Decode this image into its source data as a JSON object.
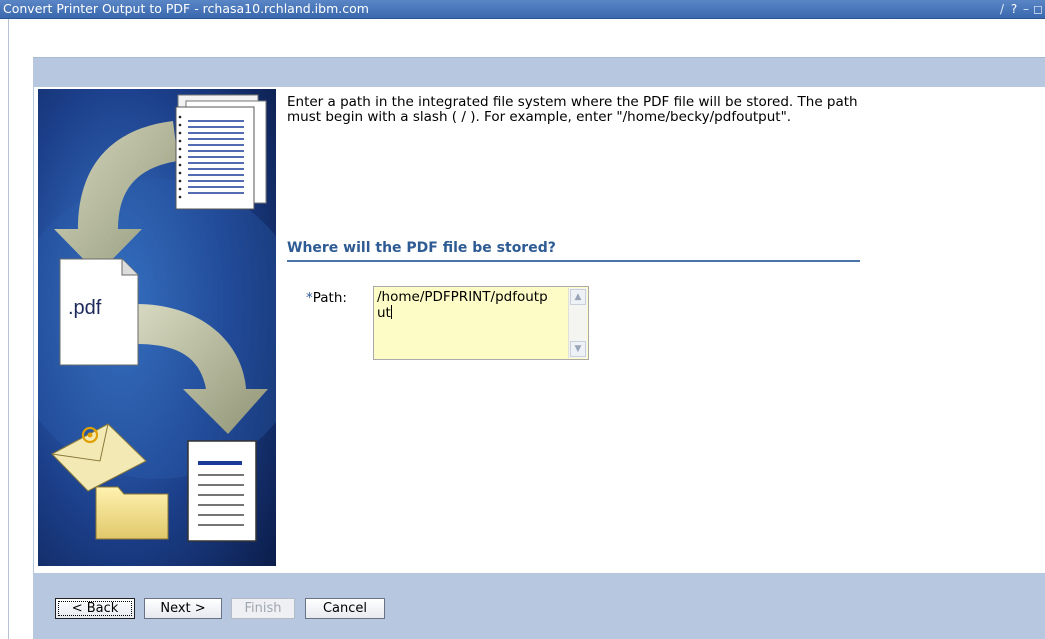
{
  "window": {
    "title": "Convert Printer Output to PDF - rchasa10.rchland.ibm.com",
    "controls": {
      "edit": "/",
      "help": "?",
      "minimize": "–",
      "restore": "◻"
    }
  },
  "illustration": {
    "file_label": ".pdf"
  },
  "main": {
    "intro": "Enter a path in the integrated file system where the PDF file will be stored. The path must begin with a slash ( / ). For example, enter \"/home/becky/pdfoutput\".",
    "section_heading": "Where will the PDF file be stored?",
    "path_field": {
      "required_marker": "*",
      "label": "Path:",
      "value": "/home/PDFPRINT/pdfoutput"
    }
  },
  "buttons": {
    "back": "< Back",
    "next": "Next >",
    "finish": "Finish",
    "cancel": "Cancel"
  }
}
